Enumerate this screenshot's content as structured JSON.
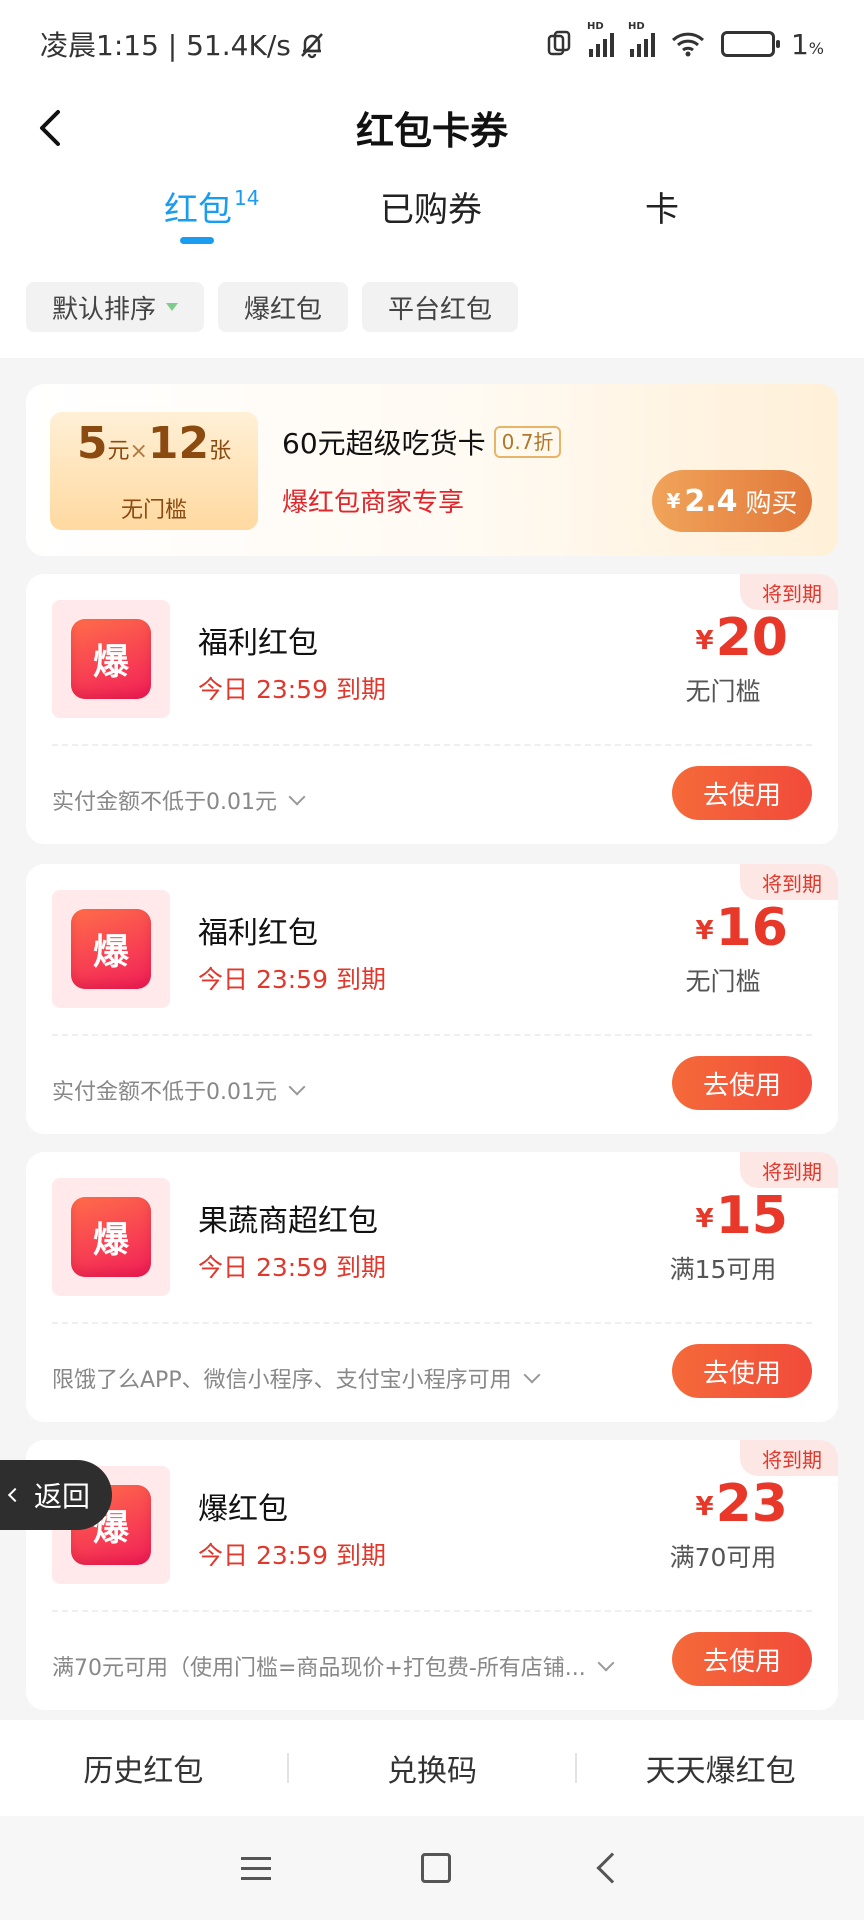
{
  "status_bar": {
    "time_speed": "凌晨1:15 | 51.4K/s",
    "signal1_label": "HD",
    "signal2_label": "HD",
    "battery": "1",
    "battery_unit": "%"
  },
  "header": {
    "title": "红包卡券"
  },
  "tabs": [
    {
      "label": "红包",
      "count": "14"
    },
    {
      "label": "已购券"
    },
    {
      "label": "卡"
    }
  ],
  "filters": [
    "默认排序",
    "爆红包",
    "平台红包"
  ],
  "promo": {
    "ticket_amount": "5",
    "ticket_unit": "元",
    "ticket_times": "×",
    "ticket_count": "12",
    "ticket_count_unit": "张",
    "ticket_sub": "无门槛",
    "title": "60元超级吃货卡",
    "discount": "0.7折",
    "desc": "爆红包商家专享",
    "buy_yen": "¥",
    "buy_price": "2.4",
    "buy_label": "购买"
  },
  "coupons": [
    {
      "tag": "将到期",
      "logo_text": "爆",
      "name": "福利红包",
      "expiry": "今日 23:59 到期",
      "yen": "¥",
      "amount": "20",
      "condition": "无门槛",
      "note": "实付金额不低于0.01元",
      "button": "去使用"
    },
    {
      "tag": "将到期",
      "logo_text": "爆",
      "name": "福利红包",
      "expiry": "今日 23:59 到期",
      "yen": "¥",
      "amount": "16",
      "condition": "无门槛",
      "note": "实付金额不低于0.01元",
      "button": "去使用"
    },
    {
      "tag": "将到期",
      "logo_text": "爆",
      "name": "果蔬商超红包",
      "expiry": "今日 23:59 到期",
      "yen": "¥",
      "amount": "15",
      "condition": "满15可用",
      "note": "限饿了么APP、微信小程序、支付宝小程序可用",
      "button": "去使用"
    },
    {
      "tag": "将到期",
      "logo_text": "爆",
      "name": "爆红包",
      "expiry": "今日 23:59 到期",
      "yen": "¥",
      "amount": "23",
      "condition": "满70可用",
      "note": "满70元可用（使用门槛=商品现价+打包费-所有店铺...",
      "button": "去使用"
    }
  ],
  "float_return": {
    "label": "返回"
  },
  "bottom_bar": [
    "历史红包",
    "兑换码",
    "天天爆红包"
  ],
  "colors": {
    "accent_blue": "#1a9df0",
    "accent_red": "#e7382a",
    "button_orange": "#f35a3a"
  }
}
